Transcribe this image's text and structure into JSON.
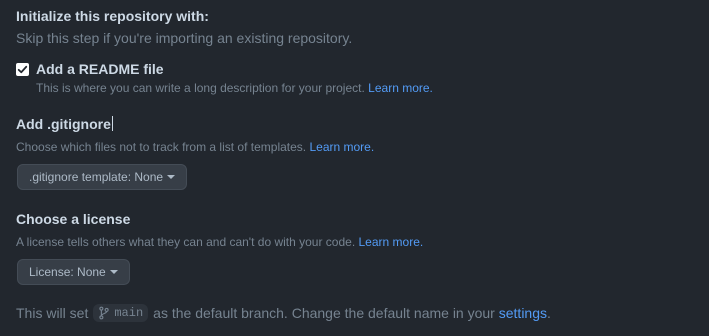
{
  "init": {
    "heading": "Initialize this repository with:",
    "subtitle": "Skip this step if you're importing an existing repository."
  },
  "readme": {
    "checked": true,
    "label": "Add a README file",
    "description": "This is where you can write a long description for your project.",
    "link": "Learn more."
  },
  "gitignore": {
    "heading": "Add .gitignore",
    "description": "Choose which files not to track from a list of templates.",
    "link": "Learn more.",
    "dropdown_label": ".gitignore template: None"
  },
  "license": {
    "heading": "Choose a license",
    "description": "A license tells others what they can and can't do with your code.",
    "link": "Learn more.",
    "dropdown_label": "License: None"
  },
  "footer": {
    "text_before": "This will set",
    "branch": "main",
    "text_after": "as the default branch. Change the default name in your",
    "link": "settings",
    "period": "."
  },
  "icons": {
    "checkbox": "check-icon",
    "branch": "git-branch-icon",
    "dropdown": "caret-down-icon"
  },
  "colors": {
    "background": "#22272e",
    "link": "#539bf5",
    "heading": "#cdd9e5",
    "muted": "#768390"
  }
}
